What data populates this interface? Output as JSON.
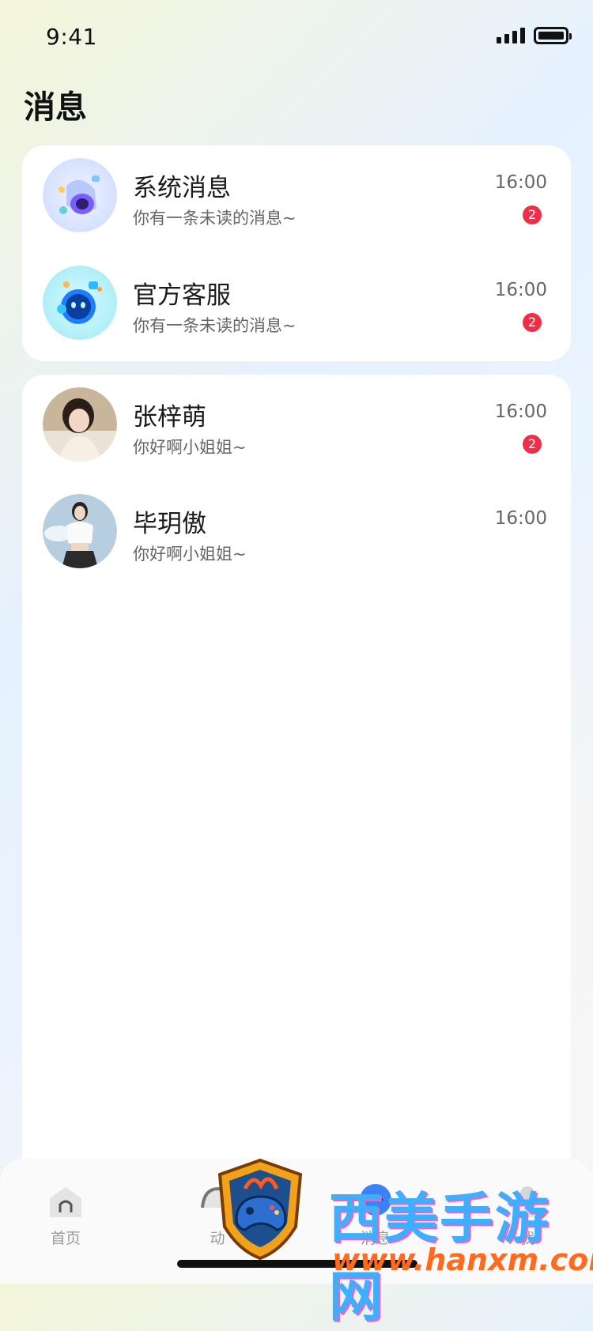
{
  "status_bar": {
    "time": "9:41"
  },
  "page_title": "消息",
  "official_list": [
    {
      "name": "系统消息",
      "preview": "你有一条未读的消息~",
      "time": "16:00",
      "unread": "2",
      "avatar_icon": "bell-icon"
    },
    {
      "name": "官方客服",
      "preview": "你有一条未读的消息~",
      "time": "16:00",
      "unread": "2",
      "avatar_icon": "robot-icon"
    }
  ],
  "chat_list": [
    {
      "name": "张梓萌",
      "preview": "你好啊小姐姐~",
      "time": "16:00",
      "unread": "2"
    },
    {
      "name": "毕玥傲",
      "preview": "你好啊小姐姐~",
      "time": "16:00"
    }
  ],
  "tabbar": [
    {
      "label": "首页",
      "icon": "home-icon"
    },
    {
      "label": "动",
      "icon": "moments-icon"
    },
    {
      "label": "消息",
      "icon": "message-icon",
      "active": true
    },
    {
      "label": "我",
      "icon": "profile-icon"
    }
  ],
  "watermark": {
    "text": "西美手游网",
    "url": "www.hanxm.com"
  },
  "colors": {
    "badge": "#f12e48",
    "accent": "#3b82f6"
  }
}
